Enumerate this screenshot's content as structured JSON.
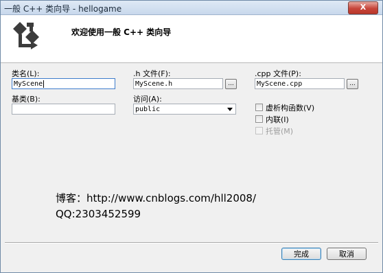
{
  "window": {
    "title": "一般 C++ 类向导 - hellogame",
    "close_label": "X"
  },
  "banner": {
    "title": "欢迎使用一般  C++  类向导",
    "logo": "wizard-logo-icon"
  },
  "form": {
    "class_name": {
      "label": "类名(L):",
      "value": "MyScene"
    },
    "h_file": {
      "label": ".h 文件(F):",
      "value": "MyScene.h",
      "browse": "..."
    },
    "cpp_file": {
      "label": ".cpp 文件(P):",
      "value": "MyScene.cpp",
      "browse": "..."
    },
    "base_class": {
      "label": "基类(B):",
      "value": ""
    },
    "access": {
      "label": "访问(A):",
      "value": "public"
    },
    "options": [
      {
        "label": "虚析构函数(V)",
        "checked": false,
        "enabled": true
      },
      {
        "label": "内联(I)",
        "checked": false,
        "enabled": true
      },
      {
        "label": "托管(M)",
        "checked": false,
        "enabled": false
      }
    ]
  },
  "watermark": {
    "line1": "博客：http://www.cnblogs.com/hll2008/",
    "line2": "QQ:2303452599"
  },
  "buttons": {
    "finish": "完成",
    "cancel": "取消"
  }
}
